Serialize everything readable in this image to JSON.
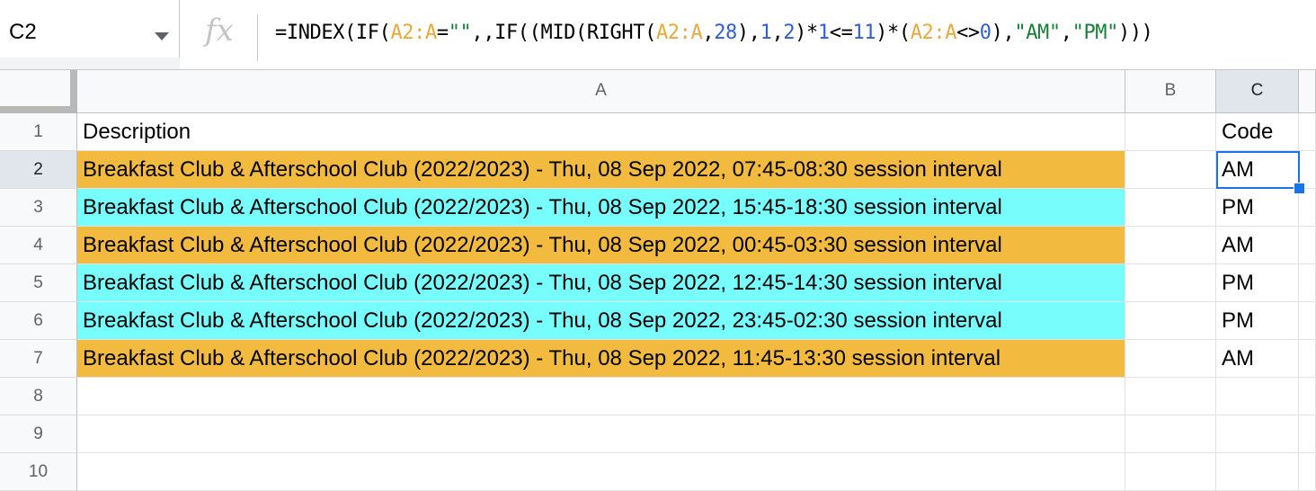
{
  "formula_bar": {
    "cell_ref": "C2",
    "fx_label": "fx",
    "formula_parts": [
      {
        "t": "=INDEX(IF(",
        "c": "plain"
      },
      {
        "t": "A2:A",
        "c": "ref"
      },
      {
        "t": "=",
        "c": "plain"
      },
      {
        "t": "\"\"",
        "c": "str"
      },
      {
        "t": ",,IF((MID(RIGHT(",
        "c": "plain"
      },
      {
        "t": "A2:A",
        "c": "ref"
      },
      {
        "t": ",",
        "c": "plain"
      },
      {
        "t": "28",
        "c": "num"
      },
      {
        "t": "),",
        "c": "plain"
      },
      {
        "t": "1",
        "c": "num"
      },
      {
        "t": ",",
        "c": "plain"
      },
      {
        "t": "2",
        "c": "num"
      },
      {
        "t": ")*",
        "c": "plain"
      },
      {
        "t": "1",
        "c": "num"
      },
      {
        "t": "<=",
        "c": "plain"
      },
      {
        "t": "11",
        "c": "num"
      },
      {
        "t": ")*(",
        "c": "plain"
      },
      {
        "t": "A2:A",
        "c": "ref"
      },
      {
        "t": "<>",
        "c": "plain"
      },
      {
        "t": "0",
        "c": "num"
      },
      {
        "t": "),",
        "c": "plain"
      },
      {
        "t": "\"AM\"",
        "c": "str"
      },
      {
        "t": ",",
        "c": "plain"
      },
      {
        "t": "\"PM\"",
        "c": "str"
      },
      {
        "t": ")))",
        "c": "plain"
      }
    ]
  },
  "columns": [
    "A",
    "B",
    "C"
  ],
  "selected_column": "C",
  "rows": [
    {
      "num": "1",
      "a": "Description",
      "b": "",
      "c": "Code",
      "fill": "none"
    },
    {
      "num": "2",
      "a": "Breakfast Club & Afterschool Club (2022/2023) - Thu, 08 Sep 2022, 07:45-08:30 session interval",
      "b": "",
      "c": "AM",
      "fill": "amber"
    },
    {
      "num": "3",
      "a": "Breakfast Club & Afterschool Club (2022/2023) - Thu, 08 Sep 2022, 15:45-18:30 session interval",
      "b": "",
      "c": "PM",
      "fill": "cyan"
    },
    {
      "num": "4",
      "a": "Breakfast Club & Afterschool Club (2022/2023) - Thu, 08 Sep 2022, 00:45-03:30 session interval",
      "b": "",
      "c": "AM",
      "fill": "amber"
    },
    {
      "num": "5",
      "a": "Breakfast Club & Afterschool Club (2022/2023) - Thu, 08 Sep 2022, 12:45-14:30 session interval",
      "b": "",
      "c": "PM",
      "fill": "cyan"
    },
    {
      "num": "6",
      "a": "Breakfast Club & Afterschool Club (2022/2023) - Thu, 08 Sep 2022, 23:45-02:30 session interval",
      "b": "",
      "c": "PM",
      "fill": "cyan"
    },
    {
      "num": "7",
      "a": "Breakfast Club & Afterschool Club (2022/2023) - Thu, 08 Sep 2022, 11:45-13:30 session interval",
      "b": "",
      "c": "AM",
      "fill": "amber"
    },
    {
      "num": "8",
      "a": "",
      "b": "",
      "c": "",
      "fill": "none"
    },
    {
      "num": "9",
      "a": "",
      "b": "",
      "c": "",
      "fill": "none"
    },
    {
      "num": "10",
      "a": "",
      "b": "",
      "c": "",
      "fill": "none"
    }
  ],
  "selected_row": "2",
  "colors": {
    "amber_fill": "#f2bb3f",
    "cyan_fill": "#76fdfc",
    "selection": "#1a73e8"
  }
}
